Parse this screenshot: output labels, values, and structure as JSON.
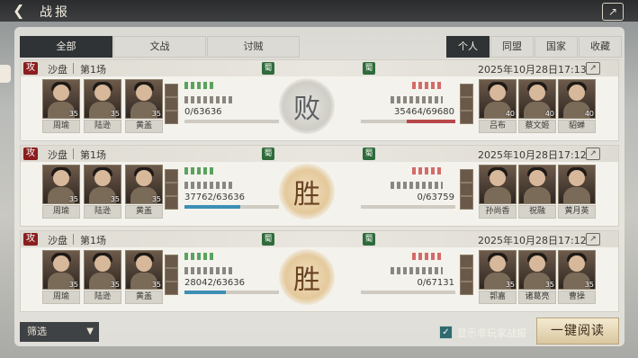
{
  "header": {
    "title": "战报",
    "back_icon": "back-arrow-icon",
    "top_icon": "share-report-icon"
  },
  "tabs": {
    "left": [
      "全部",
      "文战",
      "讨贼"
    ],
    "left_active": 0,
    "right": [
      "个人",
      "同盟",
      "国家",
      "收藏"
    ],
    "right_active": 0
  },
  "reports": [
    {
      "tag": "攻",
      "location": "沙盘",
      "round": "第1场",
      "faction": "蜀",
      "date": "2025年10月28日17:13",
      "result": "败",
      "result_type": "lose",
      "left_heroes": [
        {
          "name": "周瑜",
          "level": "35"
        },
        {
          "name": "陆逊",
          "level": "35"
        },
        {
          "name": "黄盖",
          "level": "35"
        }
      ],
      "right_heroes": [
        {
          "name": "吕布",
          "level": "40"
        },
        {
          "name": "蔡文姬",
          "level": "40"
        },
        {
          "name": "貂蝉",
          "level": "40"
        }
      ],
      "left_troops": "0/63636",
      "left_fraction": 0.0,
      "right_troops": "35464/69680",
      "right_fraction": 0.51
    },
    {
      "tag": "攻",
      "location": "沙盘",
      "round": "第1场",
      "faction": "蜀",
      "date": "2025年10月28日17:12",
      "result": "胜",
      "result_type": "win",
      "left_heroes": [
        {
          "name": "周瑜",
          "level": "35"
        },
        {
          "name": "陆逊",
          "level": "35"
        },
        {
          "name": "黄盖",
          "level": "35"
        }
      ],
      "right_heroes": [
        {
          "name": "孙尚香",
          "level": ""
        },
        {
          "name": "祝融",
          "level": ""
        },
        {
          "name": "黄月英",
          "level": ""
        }
      ],
      "left_troops": "37762/63636",
      "left_fraction": 0.59,
      "right_troops": "0/63759",
      "right_fraction": 0.0
    },
    {
      "tag": "攻",
      "location": "沙盘",
      "round": "第1场",
      "faction": "蜀",
      "date": "2025年10月28日17:12",
      "result": "胜",
      "result_type": "win",
      "left_heroes": [
        {
          "name": "周瑜",
          "level": "35"
        },
        {
          "name": "陆逊",
          "level": "35"
        },
        {
          "name": "黄盖",
          "level": "35"
        }
      ],
      "right_heroes": [
        {
          "name": "郭嘉",
          "level": "35"
        },
        {
          "name": "诸葛亮",
          "level": "35"
        },
        {
          "name": "曹操",
          "level": "35"
        }
      ],
      "left_troops": "28042/63636",
      "left_fraction": 0.44,
      "right_troops": "0/67131",
      "right_fraction": 0.0
    }
  ],
  "footer": {
    "filter_label": "筛选",
    "show_nonplayer_label": "显示非玩家战报",
    "show_nonplayer_checked": true,
    "read_all_label": "一键阅读"
  },
  "colors": {
    "active_tab": "#2f3335",
    "win": "#6a4323",
    "lose": "#5b5e63",
    "faction_shu": "#2f6b3b"
  }
}
